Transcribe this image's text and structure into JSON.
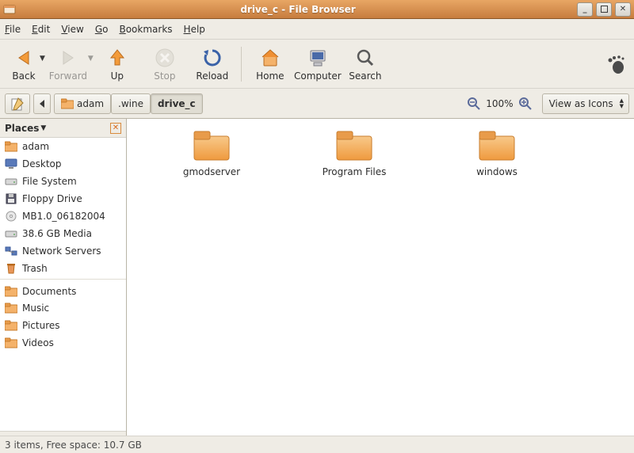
{
  "window": {
    "title": "drive_c - File Browser"
  },
  "menu": {
    "file": "File",
    "edit": "Edit",
    "view": "View",
    "go": "Go",
    "bookmarks": "Bookmarks",
    "help": "Help"
  },
  "toolbar": {
    "back": "Back",
    "forward": "Forward",
    "up": "Up",
    "stop": "Stop",
    "reload": "Reload",
    "home": "Home",
    "computer": "Computer",
    "search": "Search"
  },
  "breadcrumb": {
    "items": [
      {
        "label": "adam",
        "hasIcon": true,
        "active": false
      },
      {
        "label": ".wine",
        "hasIcon": false,
        "active": false
      },
      {
        "label": "drive_c",
        "hasIcon": false,
        "active": true
      }
    ]
  },
  "zoom": {
    "percent": "100%"
  },
  "viewmode": {
    "label": "View as Icons"
  },
  "sidebar": {
    "title": "Places",
    "items": [
      {
        "icon": "folder-home",
        "label": "adam"
      },
      {
        "icon": "desktop",
        "label": "Desktop"
      },
      {
        "icon": "drive",
        "label": "File System"
      },
      {
        "icon": "floppy",
        "label": "Floppy Drive"
      },
      {
        "icon": "cd",
        "label": "MB1.0_06182004"
      },
      {
        "icon": "drive",
        "label": "38.6 GB Media"
      },
      {
        "icon": "network",
        "label": "Network Servers"
      },
      {
        "icon": "trash",
        "label": "Trash"
      },
      {
        "icon": "folder",
        "label": "Documents",
        "sep": true
      },
      {
        "icon": "folder",
        "label": "Music"
      },
      {
        "icon": "folder",
        "label": "Pictures"
      },
      {
        "icon": "folder",
        "label": "Videos"
      }
    ]
  },
  "files": [
    {
      "label": "gmodserver"
    },
    {
      "label": "Program Files"
    },
    {
      "label": "windows"
    }
  ],
  "status": {
    "text": "3 items, Free space: 10.7 GB"
  }
}
